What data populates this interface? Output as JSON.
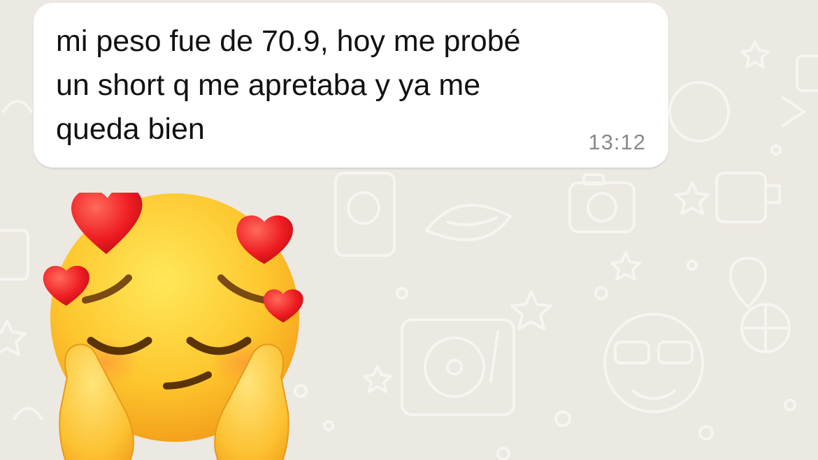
{
  "message": {
    "text": "mi peso fue de 70.9, hoy me probé\nun short q me apretaba y ya me\nqueda bien",
    "time": "13:12",
    "bubble_color": "#ffffff",
    "time_color": "#8a8a8a"
  },
  "sticker": {
    "icon": "smiling-face-with-hearts-hands-on-cheeks-icon"
  },
  "chat": {
    "background_color": "#ece8e2"
  }
}
